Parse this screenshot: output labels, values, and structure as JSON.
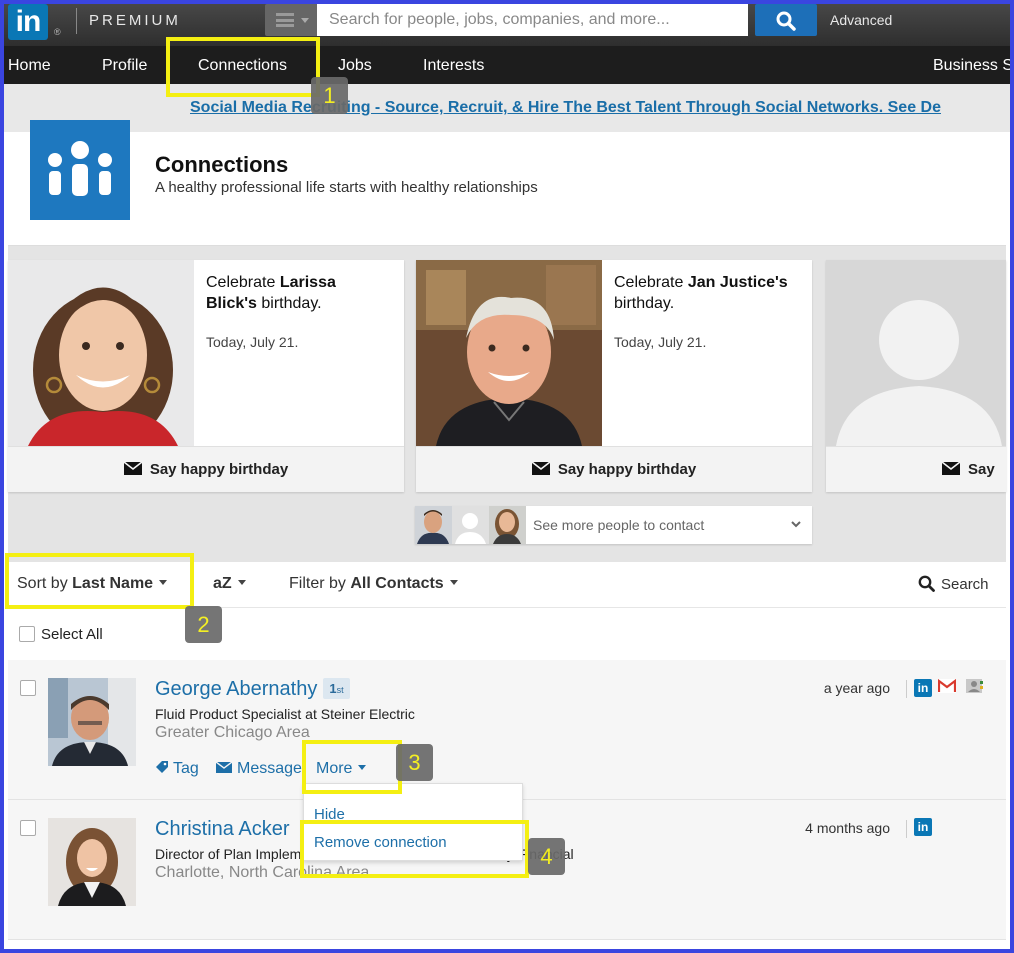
{
  "topbar": {
    "logo": "in",
    "logo_reg": "®",
    "premium": "PREMIUM",
    "search_placeholder": "Search for people, jobs, companies, and more...",
    "advanced": "Advanced"
  },
  "nav": {
    "items": [
      "Home",
      "Profile",
      "Connections",
      "Jobs",
      "Interests",
      "Business S"
    ]
  },
  "promo": {
    "text": "Social Media Recruiting - Source, Recruit, & Hire The Best Talent Through Social Networks. See De"
  },
  "header": {
    "title": "Connections",
    "subtitle": "A healthy professional life starts with healthy relationships"
  },
  "birthdays": [
    {
      "prefix": "Celebrate ",
      "name": "Larissa Blick's",
      "suffix": " birthday.",
      "date": "Today, July 21.",
      "action": "Say happy birthday"
    },
    {
      "prefix": "Celebrate ",
      "name": "Jan Justice's",
      "suffix": " birthday.",
      "date": "Today, July 21.",
      "action": "Say happy birthday"
    },
    {
      "action": "Say h"
    }
  ],
  "see_more": "See more people to contact",
  "toolbar": {
    "sort_prefix": "Sort by ",
    "sort_value": "Last Name",
    "az": "aZ",
    "filter_prefix": "Filter by ",
    "filter_value": "All Contacts",
    "search": "Search"
  },
  "select_all": "Select All",
  "contacts": [
    {
      "name": "George Abernathy",
      "degree": "1",
      "degree_suffix": "st",
      "title": "Fluid Product Specialist at Steiner Electric",
      "location": "Greater Chicago Area",
      "time": "a year ago",
      "actions": {
        "tag": "Tag",
        "message": "Message",
        "more": "More"
      }
    },
    {
      "name": "Christina Acker",
      "title": "Director of Plan Implementation and Administration at Bdy Financial",
      "location": "Charlotte, North Carolina Area",
      "time": "4 months ago"
    }
  ],
  "dropdown": {
    "items": [
      "Hide",
      "Remove connection"
    ]
  },
  "annotations": [
    "1",
    "2",
    "3",
    "4"
  ],
  "colors": {
    "linkedin_blue": "#0a77b5",
    "link_blue": "#1d6fa8",
    "highlight_yellow": "#f4ef12",
    "frame_blue": "#3a45e0"
  }
}
